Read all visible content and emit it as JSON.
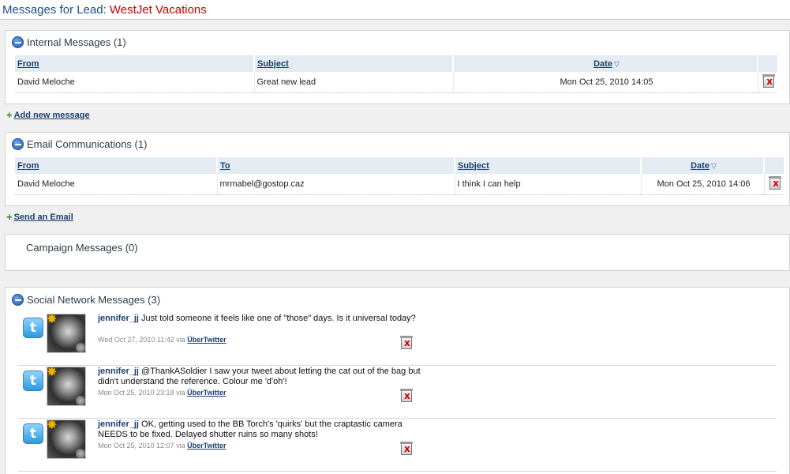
{
  "header": {
    "label": "Messages for Lead:",
    "lead_name": "WestJet Vacations"
  },
  "internal": {
    "title": "Internal Messages (1)",
    "columns": {
      "from": "From",
      "subject": "Subject",
      "date": "Date"
    },
    "rows": [
      {
        "from": "David Meloche",
        "subject": "Great new lead",
        "date": "Mon Oct 25, 2010 14:05"
      }
    ],
    "add_label": "Add new message"
  },
  "email": {
    "title": "Email Communications (1)",
    "columns": {
      "from": "From",
      "to": "To",
      "subject": "Subject",
      "date": "Date"
    },
    "rows": [
      {
        "from": "David Meloche",
        "to": "mrmabel@gostop.caz",
        "subject": "I think I can help",
        "date": "Mon Oct 25, 2010 14:06"
      }
    ],
    "add_label": "Send an Email"
  },
  "campaign": {
    "title": "Campaign Messages (0)"
  },
  "social": {
    "title": "Social Network Messages (3)",
    "via_label": "via",
    "items": [
      {
        "author": "jennifer_jj",
        "text": "Just told someone it feels like one of \"those\" days. Is it universal today?",
        "timestamp": "Wed Oct 27, 2010 11:42",
        "client": "ÜberTwitter"
      },
      {
        "author": "jennifer_jj",
        "text": "@ThankASoldier I saw your tweet about letting the cat out of the bag but didn't understand the reference. Colour me 'd'oh'!",
        "timestamp": "Mon Oct 25, 2010 23:18",
        "client": "ÜberTwitter"
      },
      {
        "author": "jennifer_jj",
        "text": "OK, getting used to the BB Torch's 'quirks' but the craptastic camera NEEDS to be fixed. Delayed shutter ruins so many shots!",
        "timestamp": "Mon Oct 25, 2010 12:07",
        "client": "ÜberTwitter"
      }
    ]
  },
  "icons": {
    "collapse": "collapse-icon",
    "delete": "delete-icon",
    "add": "plus-icon",
    "twitter": "twitter-icon",
    "sort": "sort-desc-icon",
    "favorite": "star-icon"
  },
  "colors": {
    "lead_name": "#cc0000",
    "header_label": "#1b4f8a",
    "link": "#1c3f6e",
    "table_header": "#e4ebf3",
    "add_icon": "#2e8b1e"
  }
}
